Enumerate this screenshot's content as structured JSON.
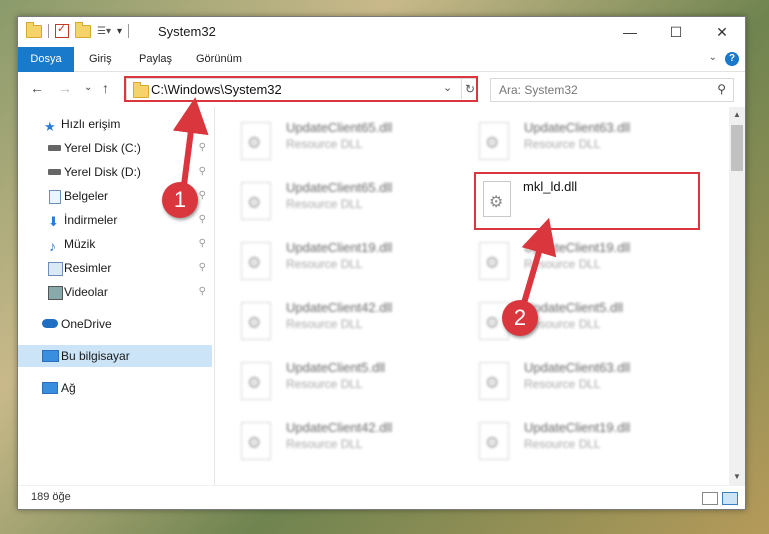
{
  "window": {
    "title": "System32",
    "minimize": "—",
    "maximize": "☐",
    "close": "✕"
  },
  "ribbon": {
    "tabs": [
      "Dosya",
      "Giriş",
      "Paylaş",
      "Görünüm"
    ],
    "help": "?",
    "expand": "⌄"
  },
  "address": {
    "path": "C:\\Windows\\System32",
    "back": "←",
    "forward": "→",
    "recent": "⌄",
    "up": "↑",
    "dropdown": "⌄",
    "refresh": "↻"
  },
  "search": {
    "placeholder": "Ara: System32",
    "icon": "search-icon"
  },
  "nav": {
    "items": [
      {
        "label": "Hızlı erişim",
        "icon": "star-icon",
        "pinned": false
      },
      {
        "label": "Yerel Disk (C:)",
        "icon": "drive-icon",
        "pinned": true
      },
      {
        "label": "Yerel Disk (D:)",
        "icon": "drive-icon",
        "pinned": true
      },
      {
        "label": "Belgeler",
        "icon": "documents-icon",
        "pinned": true
      },
      {
        "label": "İndirmeler",
        "icon": "download-icon",
        "pinned": true
      },
      {
        "label": "Müzik",
        "icon": "music-icon",
        "pinned": true
      },
      {
        "label": "Resimler",
        "icon": "pictures-icon",
        "pinned": true
      },
      {
        "label": "Videolar",
        "icon": "videos-icon",
        "pinned": true
      },
      {
        "label": "OneDrive",
        "icon": "cloud-icon",
        "pinned": false
      },
      {
        "label": "Bu bilgisayar",
        "icon": "computer-icon",
        "pinned": false,
        "selected": true
      },
      {
        "label": "Ağ",
        "icon": "network-icon",
        "pinned": false
      }
    ],
    "pin_glyph": "📌"
  },
  "files": [
    {
      "name": "UpdateClient65.dll",
      "desc": "Resource DLL"
    },
    {
      "name": "UpdateClient63.dll",
      "desc": "Resource DLL"
    },
    {
      "name": "UpdateClient65.dll",
      "desc": "Resource DLL"
    },
    {
      "name": "mkl_ld.dll",
      "desc": ""
    },
    {
      "name": "UpdateClient19.dll",
      "desc": "Resource DLL"
    },
    {
      "name": "UpdateClient19.dll",
      "desc": "Resource DLL"
    },
    {
      "name": "UpdateClient42.dll",
      "desc": "Resource DLL"
    },
    {
      "name": "UpdateClient5.dll",
      "desc": "Resource DLL"
    },
    {
      "name": "UpdateClient5.dll",
      "desc": "Resource DLL"
    },
    {
      "name": "UpdateClient63.dll",
      "desc": "Resource DLL"
    },
    {
      "name": "UpdateClient42.dll",
      "desc": "Resource DLL"
    },
    {
      "name": "UpdateClient19.dll",
      "desc": "Resource DLL"
    }
  ],
  "status": {
    "count": "189 öğe"
  },
  "annotations": {
    "badge1": "1",
    "badge2": "2",
    "color": "#d9363e"
  }
}
